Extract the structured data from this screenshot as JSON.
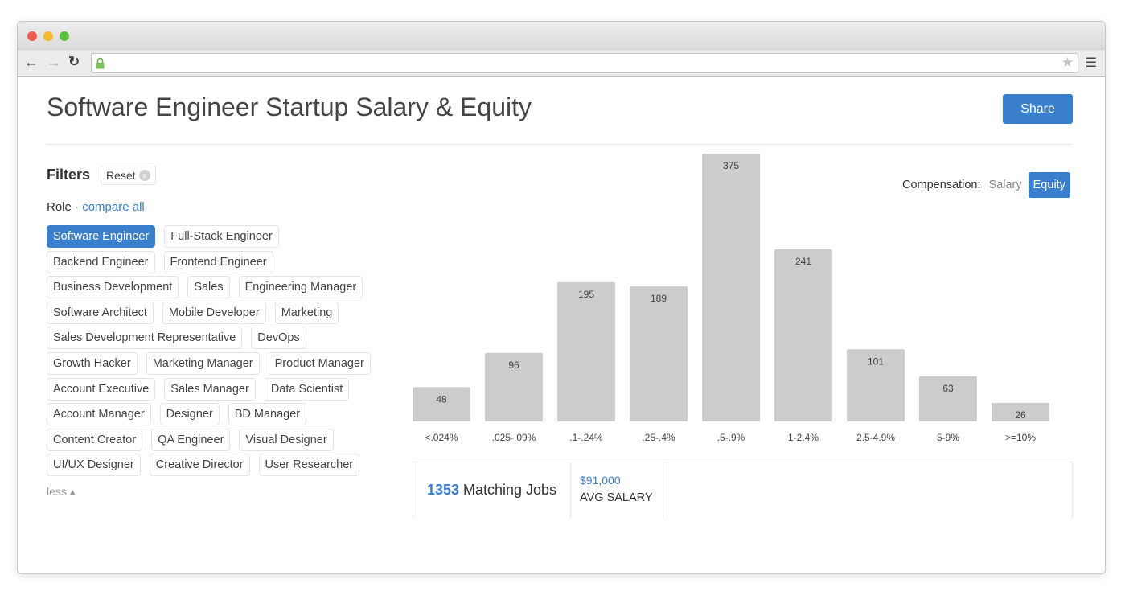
{
  "browser": {
    "controls": [
      "close",
      "minimize",
      "zoom"
    ],
    "url": ""
  },
  "page": {
    "title": "Software Engineer Startup Salary & Equity",
    "share_label": "Share"
  },
  "filters": {
    "heading": "Filters",
    "reset_label": "Reset",
    "role_label": "Role",
    "separator": " · ",
    "compare_all": "compare all",
    "less_label": "less ▴",
    "roles": [
      [
        "Software Engineer",
        "Full-Stack Engineer"
      ],
      [
        "Backend Engineer",
        "Frontend Engineer"
      ],
      [
        "Business Development",
        "Sales",
        "Engineering Manager"
      ],
      [
        "Software Architect",
        "Mobile Developer",
        "Marketing"
      ],
      [
        "Sales Development Representative",
        "DevOps"
      ],
      [
        "Growth Hacker",
        "Marketing Manager",
        "Product Manager"
      ],
      [
        "Account Executive",
        "Sales Manager",
        "Data Scientist"
      ],
      [
        "Account Manager",
        "Designer",
        "BD Manager"
      ],
      [
        "Content Creator",
        "QA Engineer",
        "Visual Designer"
      ],
      [
        "UI/UX Designer",
        "Creative Director",
        "User Researcher"
      ]
    ],
    "selected_role": "Software Engineer"
  },
  "compensation": {
    "label": "Compensation:",
    "options": [
      "Salary",
      "Equity"
    ],
    "selected": "Equity"
  },
  "chart_data": {
    "type": "bar",
    "categories": [
      "<.024%",
      ".025-.09%",
      ".1-.24%",
      ".25-.4%",
      ".5-.9%",
      "1-2.4%",
      "2.5-4.9%",
      "5-9%",
      ">=10%"
    ],
    "values": [
      48,
      96,
      195,
      189,
      375,
      241,
      101,
      63,
      26
    ],
    "bar_color": "#cccccc",
    "data_labels": true,
    "grid": false
  },
  "stats": {
    "matching_count": "1353",
    "matching_label": "Matching Jobs",
    "avg_value": "$91,000",
    "avg_label": "AVG SALARY"
  },
  "colors": {
    "accent": "#3a7fcc"
  }
}
